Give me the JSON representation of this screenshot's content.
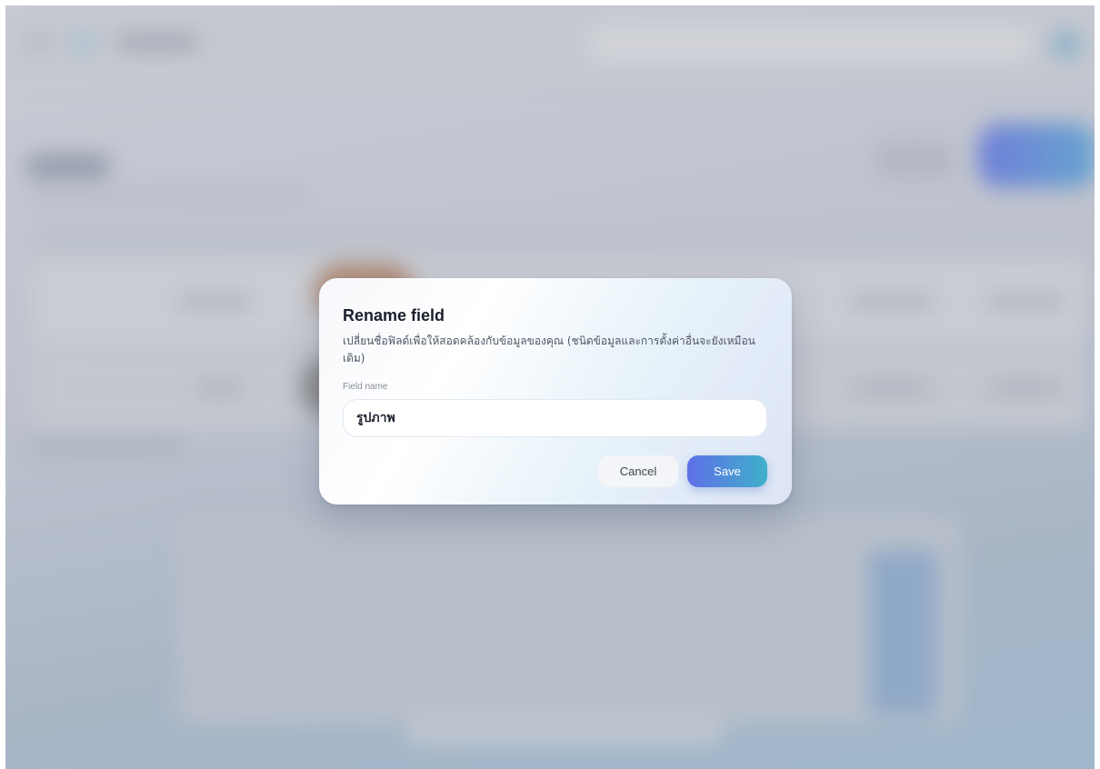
{
  "dialog": {
    "title": "Rename field",
    "description": "เปลี่ยนชื่อฟิลด์เพื่อให้สอดคล้องกับข้อมูลของคุณ (ชนิดข้อมูลและการตั้งค่าอื่นจะยังเหมือนเดิม)",
    "field_label": "Field name",
    "field_value": "รูปภาพ",
    "cancel_label": "Cancel",
    "save_label": "Save"
  },
  "colors": {
    "save_gradient_start": "#5f6fe8",
    "save_gradient_end": "#3fb0c9",
    "title_text": "#1c1f2b"
  }
}
